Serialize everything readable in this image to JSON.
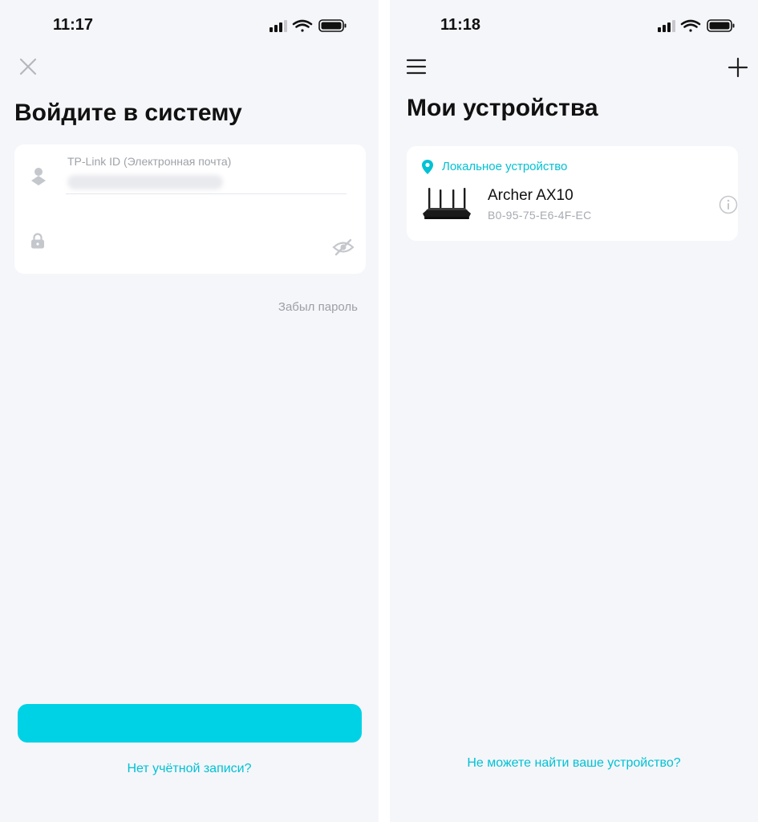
{
  "colors": {
    "accent": "#00d2e6",
    "link": "#00c2d4",
    "background": "#f5f6fa",
    "card": "#ffffff"
  },
  "left_screen": {
    "status_bar": {
      "time": "11:17",
      "icons": [
        "cellular-signal-icon",
        "wifi-icon",
        "battery-icon"
      ]
    },
    "close_icon": "close-icon",
    "title": "Войдите в систему",
    "form": {
      "email_label": "TP-Link ID (Электронная почта)",
      "email_value": "",
      "password_value": "",
      "icons": [
        "user-icon",
        "lock-icon",
        "eye-off-icon"
      ]
    },
    "forgot_password": "Забыл пароль",
    "login_button_label": "",
    "no_account": "Нет учётной записи?"
  },
  "right_screen": {
    "status_bar": {
      "time": "11:18",
      "icons": [
        "cellular-signal-icon",
        "wifi-icon",
        "battery-icon"
      ]
    },
    "menu_icon": "menu-icon",
    "add_icon": "plus-icon",
    "title": "Мои устройства",
    "section": {
      "label": "Локальное устройство",
      "icon": "location-pin-icon",
      "devices": [
        {
          "name": "Archer AX10",
          "mac": "B0-95-75-E6-4F-EC",
          "icon": "router-image"
        }
      ]
    },
    "cant_find": "Не можете найти ваше устройство?"
  }
}
